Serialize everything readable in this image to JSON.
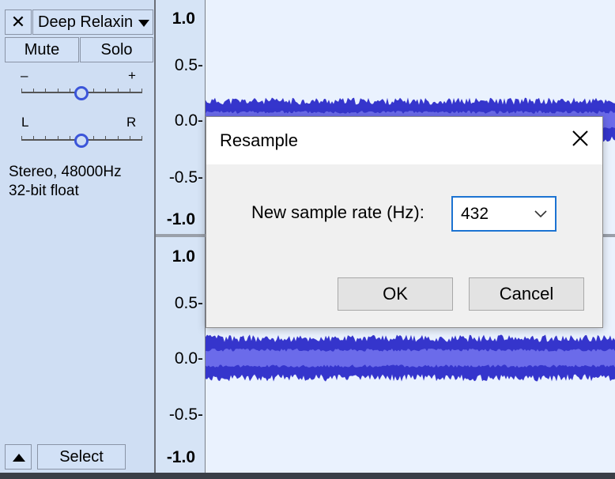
{
  "track": {
    "name": "Deep Relaxin",
    "mute_label": "Mute",
    "solo_label": "Solo",
    "gain": {
      "minus": "–",
      "plus": "+",
      "level": 0.5
    },
    "pan": {
      "left": "L",
      "right": "R",
      "level": 0.5
    },
    "info_line1": "Stereo, 48000Hz",
    "info_line2": "32-bit float",
    "select_label": "Select"
  },
  "ruler": {
    "upper": [
      "1.0",
      "0.5-",
      "0.0-",
      "-0.5-",
      "-1.0"
    ],
    "lower": [
      "1.0",
      "0.5-",
      "0.0-",
      "-0.5-",
      "-1.0"
    ]
  },
  "dialog": {
    "title": "Resample",
    "rate_label": "New sample rate (Hz):",
    "rate_value": "432",
    "ok_label": "OK",
    "cancel_label": "Cancel"
  },
  "colors": {
    "waveform_dark": "#3232c8",
    "waveform_light": "#6a6ae8",
    "track_panel": "#cfdef3",
    "wave_background": "#eaf2fe",
    "focus_border": "#1c73d2"
  }
}
